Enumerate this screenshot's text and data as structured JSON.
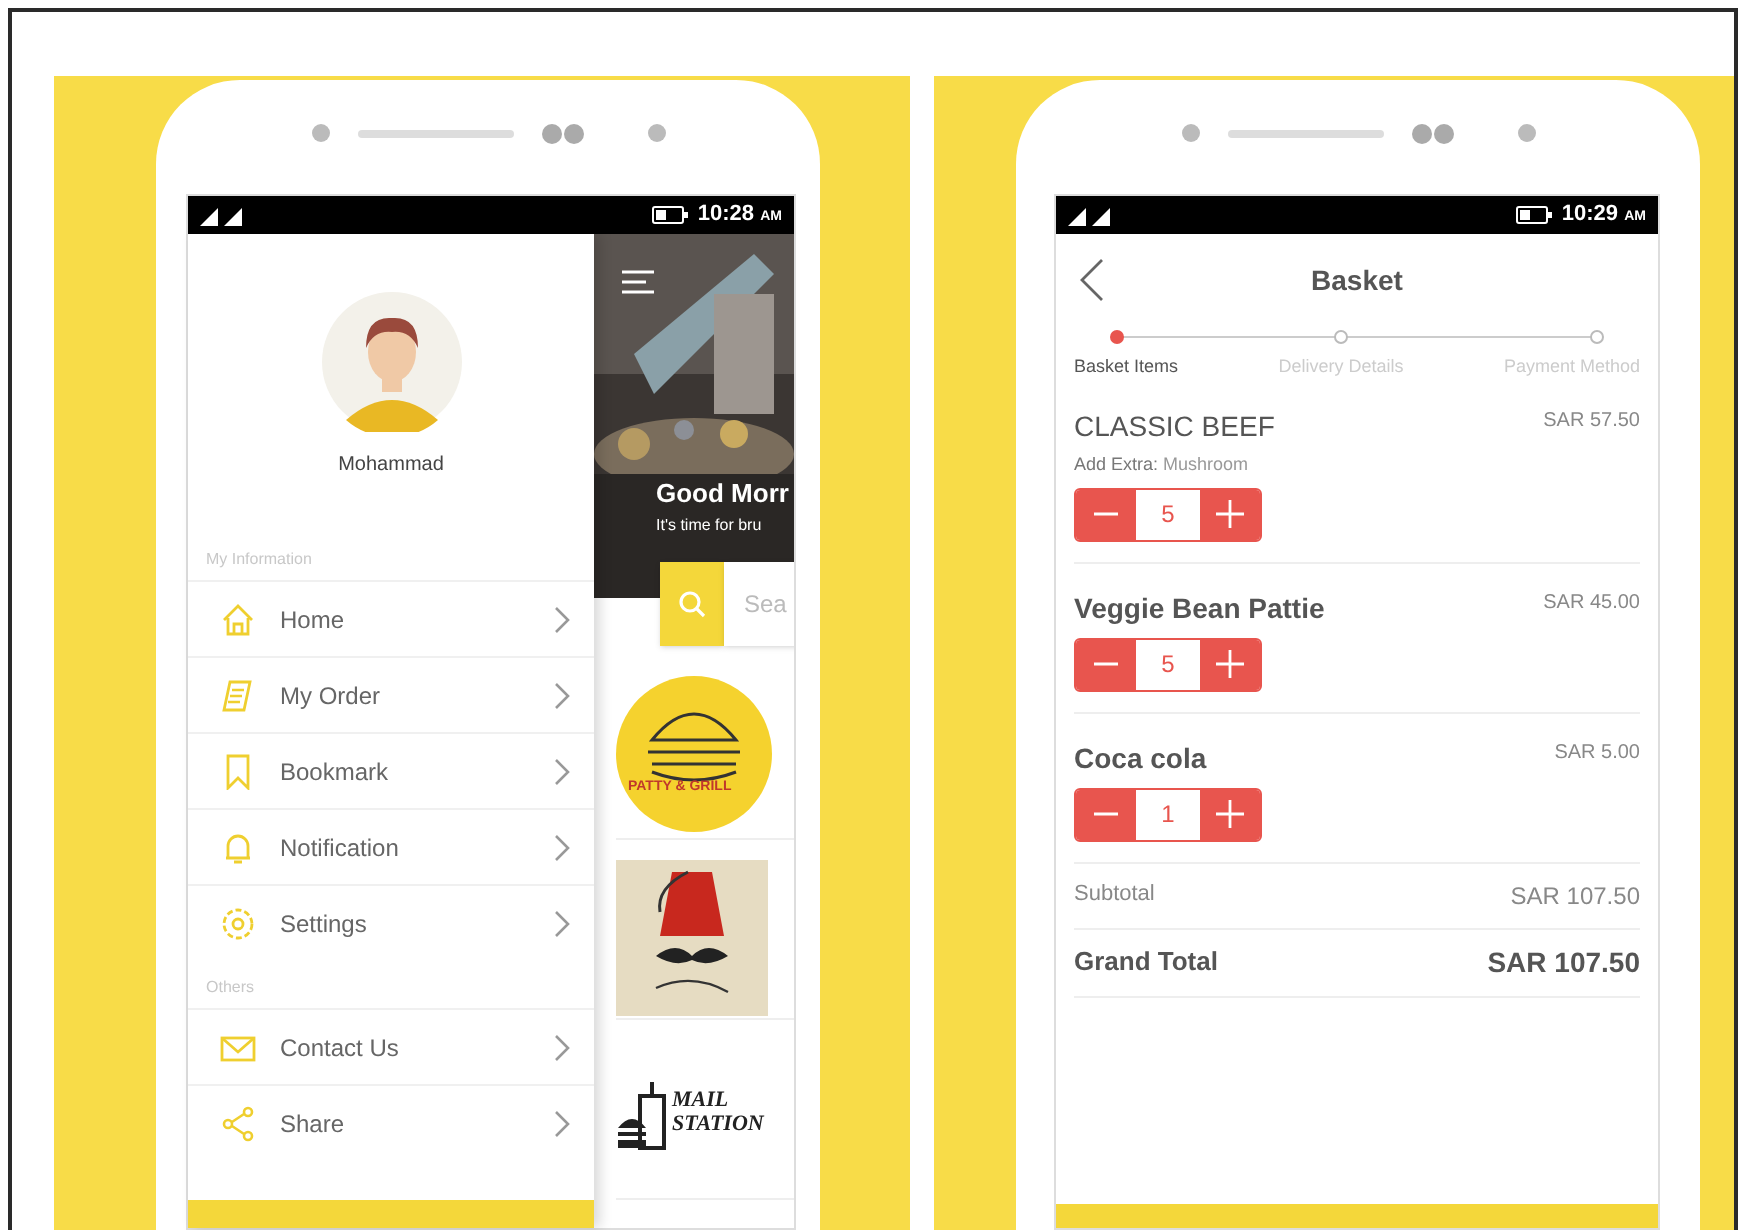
{
  "menu_phone": {
    "status_bar": {
      "time": "10:28",
      "meridiem": "AM"
    },
    "user_name": "Mohammad",
    "sections": [
      {
        "label": "My Information",
        "items": [
          {
            "kind": "home",
            "label": "Home"
          },
          {
            "kind": "order",
            "label": "My Order"
          },
          {
            "kind": "bookmark",
            "label": "Bookmark"
          },
          {
            "kind": "bell",
            "label": "Notification"
          },
          {
            "kind": "gear",
            "label": "Settings"
          }
        ]
      },
      {
        "label": "Others",
        "items": [
          {
            "kind": "mail",
            "label": "Contact Us"
          },
          {
            "kind": "share",
            "label": "Share"
          }
        ]
      }
    ],
    "home": {
      "greeting": "Good Morr",
      "subtitle": "It's time for bru",
      "search_placeholder": "Sea",
      "restaurants": [
        {
          "kind": "burger",
          "logo_text": "PATTY & GRILL"
        },
        {
          "kind": "fez"
        },
        {
          "kind": "station",
          "logo_text": "MAIL STATION"
        }
      ]
    }
  },
  "basket_phone": {
    "status_bar": {
      "time": "10:29",
      "meridiem": "AM"
    },
    "title": "Basket",
    "steps": [
      {
        "label": "Basket Items",
        "selected": true
      },
      {
        "label": "Delivery Details",
        "selected": false
      },
      {
        "label": "Payment Method",
        "selected": false
      }
    ],
    "items": [
      {
        "name": "CLASSIC BEEF",
        "extra_label": "Add Extra:",
        "extra_value": "Mushroom",
        "price": "SAR 57.50",
        "quantity": "5"
      },
      {
        "name": "Veggie Bean Pattie",
        "price": "SAR 45.00",
        "quantity": "5"
      },
      {
        "name": "Coca cola",
        "price": "SAR 5.00",
        "quantity": "1"
      }
    ],
    "subtotal_label": "Subtotal",
    "subtotal": "SAR 107.50",
    "grand_total_label": "Grand Total",
    "grand_total": "SAR 107.50"
  }
}
